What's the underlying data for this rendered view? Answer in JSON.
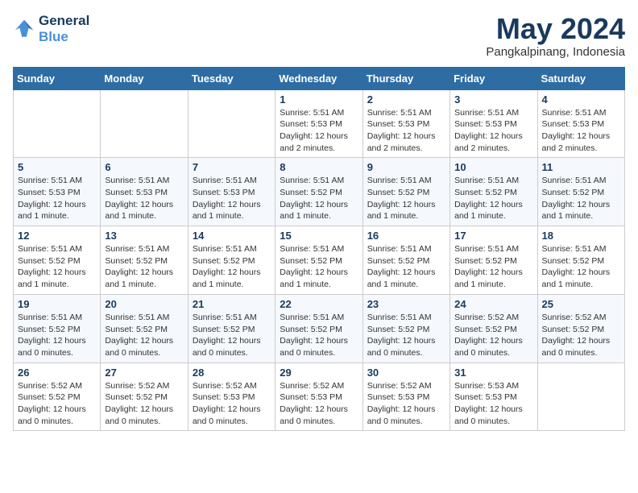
{
  "logo": {
    "line1": "General",
    "line2": "Blue"
  },
  "title": "May 2024",
  "subtitle": "Pangkalpinang, Indonesia",
  "weekdays": [
    "Sunday",
    "Monday",
    "Tuesday",
    "Wednesday",
    "Thursday",
    "Friday",
    "Saturday"
  ],
  "weeks": [
    [
      {
        "day": "",
        "info": ""
      },
      {
        "day": "",
        "info": ""
      },
      {
        "day": "",
        "info": ""
      },
      {
        "day": "1",
        "info": "Sunrise: 5:51 AM\nSunset: 5:53 PM\nDaylight: 12 hours\nand 2 minutes."
      },
      {
        "day": "2",
        "info": "Sunrise: 5:51 AM\nSunset: 5:53 PM\nDaylight: 12 hours\nand 2 minutes."
      },
      {
        "day": "3",
        "info": "Sunrise: 5:51 AM\nSunset: 5:53 PM\nDaylight: 12 hours\nand 2 minutes."
      },
      {
        "day": "4",
        "info": "Sunrise: 5:51 AM\nSunset: 5:53 PM\nDaylight: 12 hours\nand 2 minutes."
      }
    ],
    [
      {
        "day": "5",
        "info": "Sunrise: 5:51 AM\nSunset: 5:53 PM\nDaylight: 12 hours\nand 1 minute."
      },
      {
        "day": "6",
        "info": "Sunrise: 5:51 AM\nSunset: 5:53 PM\nDaylight: 12 hours\nand 1 minute."
      },
      {
        "day": "7",
        "info": "Sunrise: 5:51 AM\nSunset: 5:53 PM\nDaylight: 12 hours\nand 1 minute."
      },
      {
        "day": "8",
        "info": "Sunrise: 5:51 AM\nSunset: 5:52 PM\nDaylight: 12 hours\nand 1 minute."
      },
      {
        "day": "9",
        "info": "Sunrise: 5:51 AM\nSunset: 5:52 PM\nDaylight: 12 hours\nand 1 minute."
      },
      {
        "day": "10",
        "info": "Sunrise: 5:51 AM\nSunset: 5:52 PM\nDaylight: 12 hours\nand 1 minute."
      },
      {
        "day": "11",
        "info": "Sunrise: 5:51 AM\nSunset: 5:52 PM\nDaylight: 12 hours\nand 1 minute."
      }
    ],
    [
      {
        "day": "12",
        "info": "Sunrise: 5:51 AM\nSunset: 5:52 PM\nDaylight: 12 hours\nand 1 minute."
      },
      {
        "day": "13",
        "info": "Sunrise: 5:51 AM\nSunset: 5:52 PM\nDaylight: 12 hours\nand 1 minute."
      },
      {
        "day": "14",
        "info": "Sunrise: 5:51 AM\nSunset: 5:52 PM\nDaylight: 12 hours\nand 1 minute."
      },
      {
        "day": "15",
        "info": "Sunrise: 5:51 AM\nSunset: 5:52 PM\nDaylight: 12 hours\nand 1 minute."
      },
      {
        "day": "16",
        "info": "Sunrise: 5:51 AM\nSunset: 5:52 PM\nDaylight: 12 hours\nand 1 minute."
      },
      {
        "day": "17",
        "info": "Sunrise: 5:51 AM\nSunset: 5:52 PM\nDaylight: 12 hours\nand 1 minute."
      },
      {
        "day": "18",
        "info": "Sunrise: 5:51 AM\nSunset: 5:52 PM\nDaylight: 12 hours\nand 1 minute."
      }
    ],
    [
      {
        "day": "19",
        "info": "Sunrise: 5:51 AM\nSunset: 5:52 PM\nDaylight: 12 hours\nand 0 minutes."
      },
      {
        "day": "20",
        "info": "Sunrise: 5:51 AM\nSunset: 5:52 PM\nDaylight: 12 hours\nand 0 minutes."
      },
      {
        "day": "21",
        "info": "Sunrise: 5:51 AM\nSunset: 5:52 PM\nDaylight: 12 hours\nand 0 minutes."
      },
      {
        "day": "22",
        "info": "Sunrise: 5:51 AM\nSunset: 5:52 PM\nDaylight: 12 hours\nand 0 minutes."
      },
      {
        "day": "23",
        "info": "Sunrise: 5:51 AM\nSunset: 5:52 PM\nDaylight: 12 hours\nand 0 minutes."
      },
      {
        "day": "24",
        "info": "Sunrise: 5:52 AM\nSunset: 5:52 PM\nDaylight: 12 hours\nand 0 minutes."
      },
      {
        "day": "25",
        "info": "Sunrise: 5:52 AM\nSunset: 5:52 PM\nDaylight: 12 hours\nand 0 minutes."
      }
    ],
    [
      {
        "day": "26",
        "info": "Sunrise: 5:52 AM\nSunset: 5:52 PM\nDaylight: 12 hours\nand 0 minutes."
      },
      {
        "day": "27",
        "info": "Sunrise: 5:52 AM\nSunset: 5:52 PM\nDaylight: 12 hours\nand 0 minutes."
      },
      {
        "day": "28",
        "info": "Sunrise: 5:52 AM\nSunset: 5:53 PM\nDaylight: 12 hours\nand 0 minutes."
      },
      {
        "day": "29",
        "info": "Sunrise: 5:52 AM\nSunset: 5:53 PM\nDaylight: 12 hours\nand 0 minutes."
      },
      {
        "day": "30",
        "info": "Sunrise: 5:52 AM\nSunset: 5:53 PM\nDaylight: 12 hours\nand 0 minutes."
      },
      {
        "day": "31",
        "info": "Sunrise: 5:53 AM\nSunset: 5:53 PM\nDaylight: 12 hours\nand 0 minutes."
      },
      {
        "day": "",
        "info": ""
      }
    ]
  ]
}
